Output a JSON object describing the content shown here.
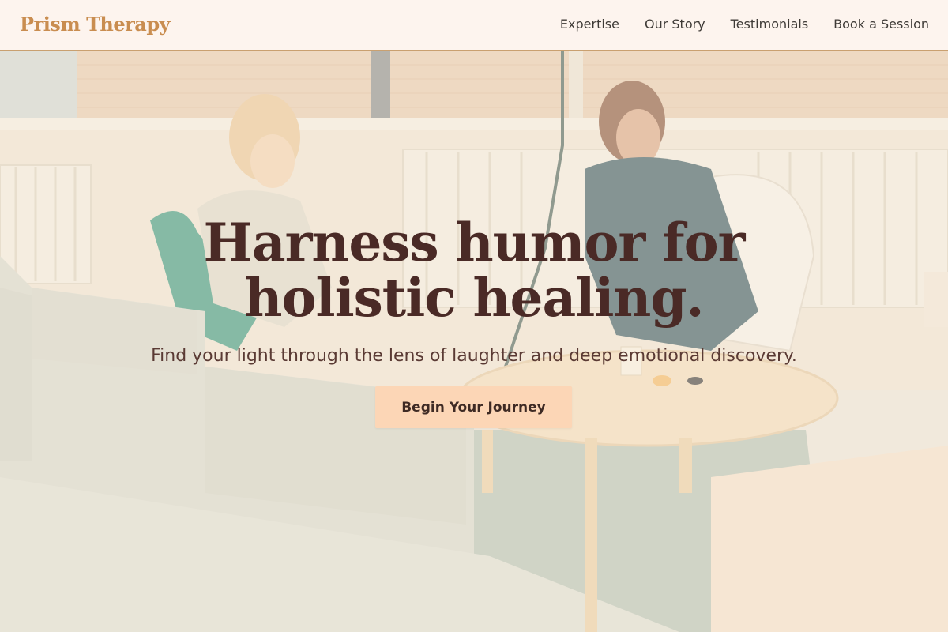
{
  "nav": {
    "brand": "Prism Therapy",
    "links": [
      "Expertise",
      "Our Story",
      "Testimonials",
      "Book a Session"
    ]
  },
  "hero": {
    "title_line1": "Harness humor for",
    "title_line2": "holistic healing.",
    "subtitle": "Find your light through the lens of laughter and deep emotional discovery.",
    "cta_label": "Begin Your Journey",
    "background_description": "photo-therapy-session-bright-room"
  },
  "colors": {
    "brand": "#c98d50",
    "nav_bg": "#fdf4ee",
    "title": "#4a2a26",
    "cta_bg": "#fcd6b6",
    "text": "#3e3a36"
  }
}
